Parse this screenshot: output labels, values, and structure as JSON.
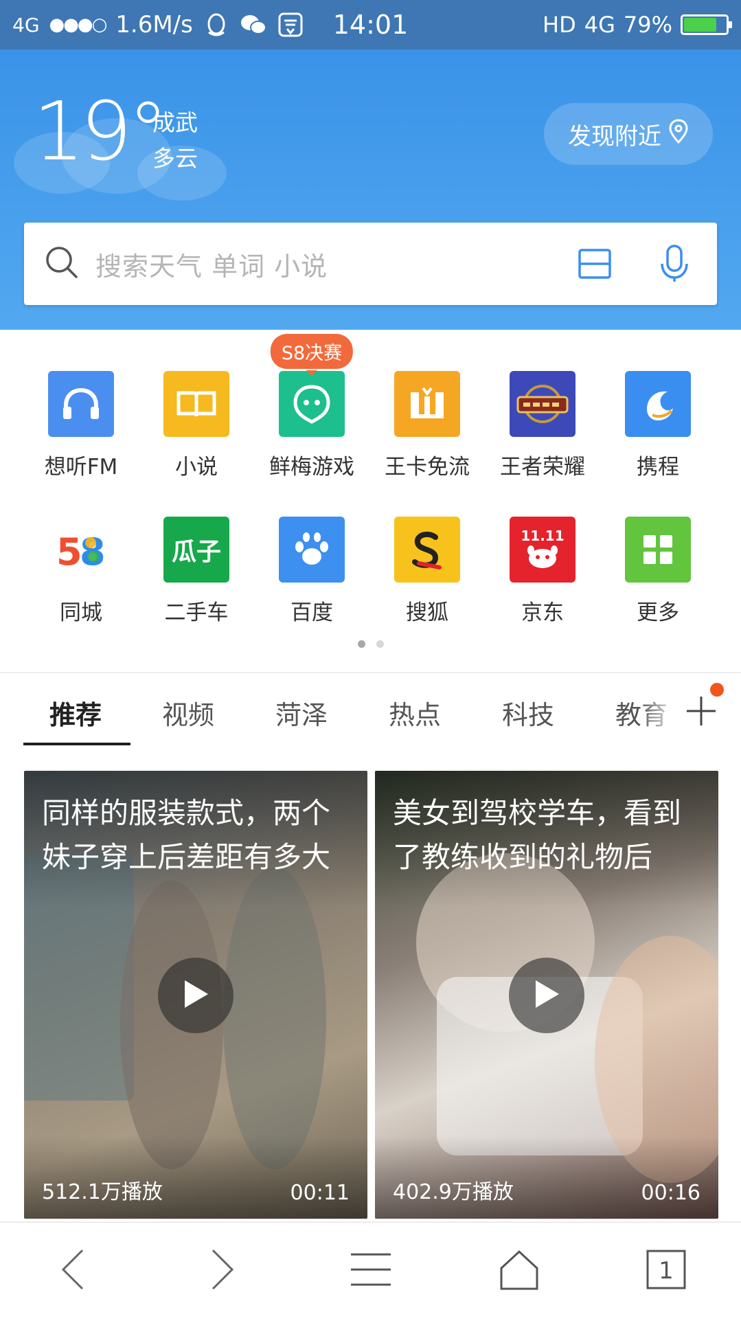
{
  "status_bar": {
    "network": "4G",
    "signal_dots": "●●●○",
    "speed": "1.6M/s",
    "time": "14:01",
    "hd": "HD",
    "net_type": "4G",
    "battery_percent": "79%",
    "battery_level": 0.79
  },
  "weather": {
    "temperature": "19°",
    "city": "成武",
    "condition": "多云"
  },
  "nearby_button": {
    "label": "发现附近"
  },
  "search": {
    "placeholder": "搜索天气 单词 小说"
  },
  "apps": [
    {
      "label": "想听FM",
      "icon": "headphones-icon",
      "color": "#4a8ff0"
    },
    {
      "label": "小说",
      "icon": "book-icon",
      "color": "#f6b91f"
    },
    {
      "label": "鲜梅游戏",
      "icon": "game-face-icon",
      "color": "#1cbf8d",
      "badge": "S8决赛"
    },
    {
      "label": "王卡免流",
      "icon": "wang-card-icon",
      "color": "#f5a623"
    },
    {
      "label": "王者荣耀",
      "icon": "honor-of-kings-icon",
      "color": "#3d49b8"
    },
    {
      "label": "携程",
      "icon": "dolphin-icon",
      "color": "#3a8ef0"
    },
    {
      "label": "同城",
      "icon": "58-logo-icon",
      "color": "#ffffff"
    },
    {
      "label": "二手车",
      "icon": "guazi-logo-icon",
      "color": "#16a84a",
      "logo_text": "瓜子"
    },
    {
      "label": "百度",
      "icon": "paw-icon",
      "color": "#3d8ff0"
    },
    {
      "label": "搜狐",
      "icon": "sohu-logo-icon",
      "color": "#f7c21b"
    },
    {
      "label": "京东",
      "icon": "jd-logo-icon",
      "color": "#e4232d",
      "logo_text": "11.11"
    },
    {
      "label": "更多",
      "icon": "grid-more-icon",
      "color": "#63c43d"
    }
  ],
  "pager": {
    "pages": 2,
    "active": 0
  },
  "tabs": [
    {
      "label": "推荐",
      "active": true
    },
    {
      "label": "视频"
    },
    {
      "label": "菏泽"
    },
    {
      "label": "热点"
    },
    {
      "label": "科技"
    },
    {
      "label": "教育"
    }
  ],
  "videos": [
    {
      "title": "同样的服装款式，两个妹子穿上后差距有多大",
      "views": "512.1万播放",
      "duration": "00:11"
    },
    {
      "title": "美女到驾校学车，看到了教练收到的礼物后",
      "views": "402.9万播放",
      "duration": "00:16"
    }
  ],
  "bottom_nav": {
    "tabs_count": "1"
  }
}
